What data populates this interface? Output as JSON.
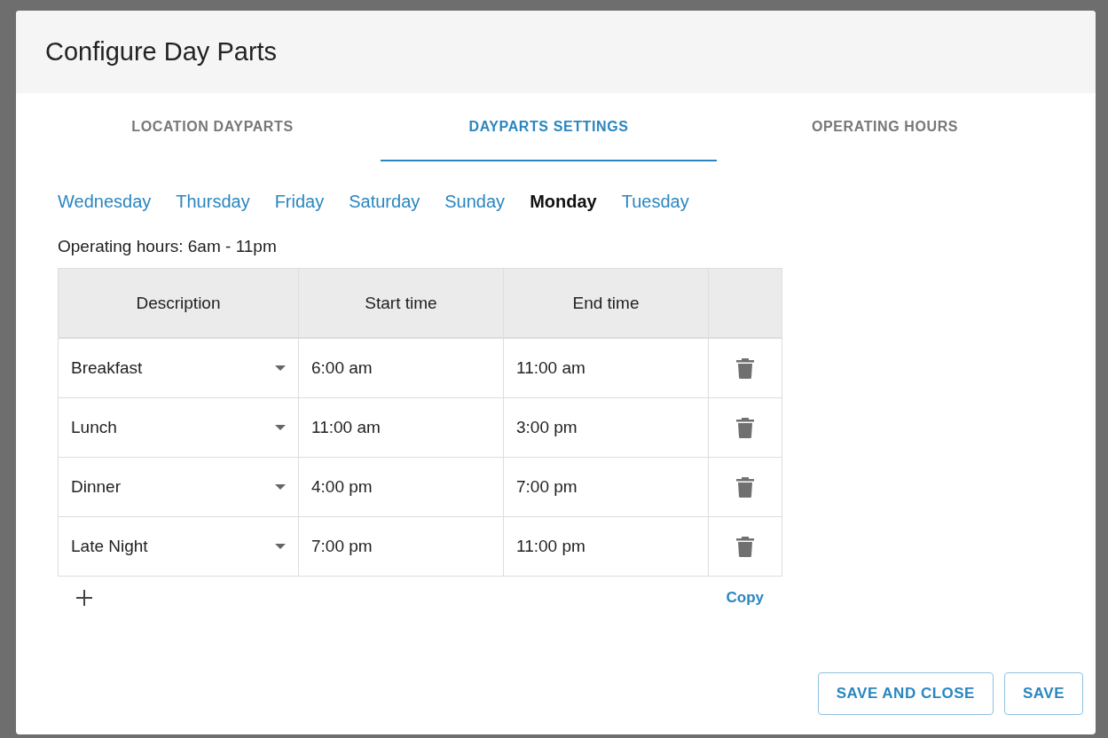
{
  "dialog": {
    "title": "Configure Day Parts"
  },
  "tabs": [
    {
      "label": "LOCATION DAYPARTS",
      "selected": false
    },
    {
      "label": "DAYPARTS SETTINGS",
      "selected": true
    },
    {
      "label": "OPERATING HOURS",
      "selected": false
    }
  ],
  "days": [
    {
      "label": "Wednesday",
      "selected": false
    },
    {
      "label": "Thursday",
      "selected": false
    },
    {
      "label": "Friday",
      "selected": false
    },
    {
      "label": "Saturday",
      "selected": false
    },
    {
      "label": "Sunday",
      "selected": false
    },
    {
      "label": "Monday",
      "selected": true
    },
    {
      "label": "Tuesday",
      "selected": false
    }
  ],
  "operating_hours": "Operating hours: 6am - 11pm",
  "table": {
    "columns": [
      "Description",
      "Start time",
      "End time"
    ],
    "rows": [
      {
        "description": "Breakfast",
        "start": "6:00 am",
        "end": "11:00 am"
      },
      {
        "description": "Lunch",
        "start": "11:00 am",
        "end": "3:00 pm"
      },
      {
        "description": "Dinner",
        "start": "4:00 pm",
        "end": "7:00 pm"
      },
      {
        "description": "Late Night",
        "start": "7:00 pm",
        "end": "11:00 pm"
      }
    ]
  },
  "copy_link": "Copy",
  "buttons": [
    "SAVE AND CLOSE",
    "SAVE"
  ]
}
